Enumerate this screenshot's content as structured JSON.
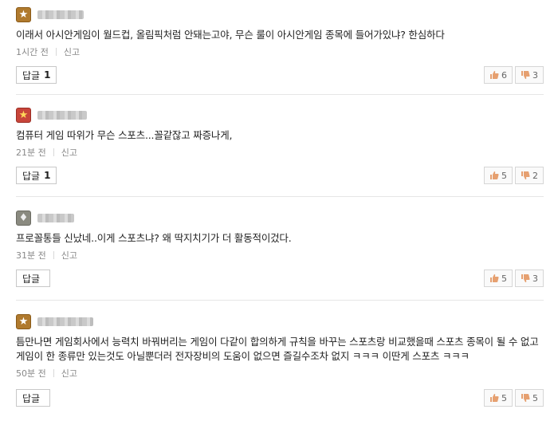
{
  "comments": [
    {
      "rank": "gold",
      "text": "이래서 아시안게임이 월드컵, 올림픽처럼 안돼는고야, 무슨 룰이 아시안게임 종목에 들어가있냐? 한심하다",
      "time": "1시간 전",
      "report": "신고",
      "reply_label": "답글",
      "reply_count": "1",
      "likes": "6",
      "dislikes": "3"
    },
    {
      "rank": "red",
      "text": "컴퓨터 게임 따위가 무슨 스포츠...꼴같잖고 짜증나게,",
      "time": "21분 전",
      "report": "신고",
      "reply_label": "답글",
      "reply_count": "1",
      "likes": "5",
      "dislikes": "2"
    },
    {
      "rank": "gray",
      "text": "프로꼴통들 신났네..이게 스포츠냐? 왜 딱지치기가 더 활동적이겄다.",
      "time": "31분 전",
      "report": "신고",
      "reply_label": "답글",
      "reply_count": "",
      "likes": "5",
      "dislikes": "3"
    },
    {
      "rank": "gold",
      "text": "틈만나면 게임회사에서 능력치 바꿔버리는 게임이 다같이 합의하게 규칙을 바꾸는 스포츠랑 비교했을때 스포츠 종목이 될 수 없고 게임이 한 종류만 있는것도 아닐뿐더러 전자장비의 도움이 없으면 즐길수조차 없지 ㅋㅋㅋ 이딴게 스포츠 ㅋㅋㅋ",
      "time": "50분 전",
      "report": "신고",
      "reply_label": "답글",
      "reply_count": "",
      "likes": "5",
      "dislikes": "5"
    }
  ],
  "icons": {
    "like": "thumbs-up-icon",
    "dislike": "thumbs-down-icon",
    "badge": "rank-badge-icon"
  }
}
